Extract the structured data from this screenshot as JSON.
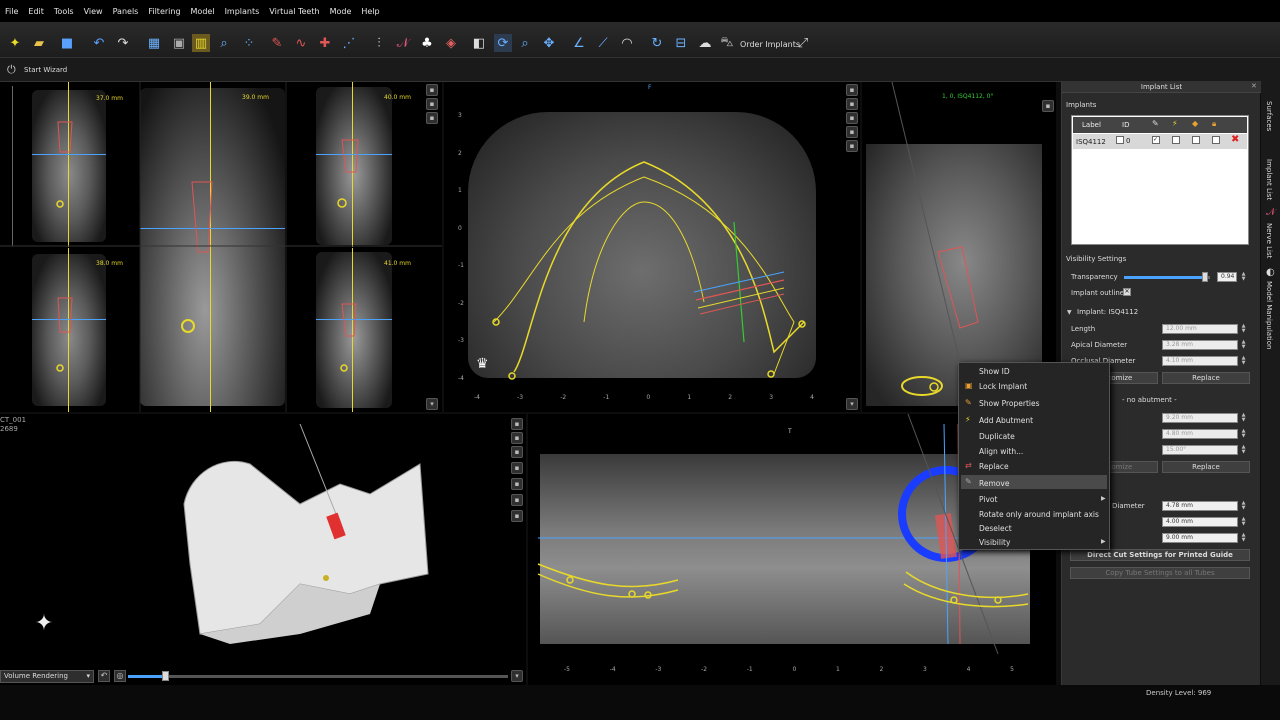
{
  "menu": [
    "File",
    "Edit",
    "Tools",
    "View",
    "Panels",
    "Filtering",
    "Model",
    "Implants",
    "Virtual Teeth",
    "Mode",
    "Help"
  ],
  "toolbar": {
    "order_label": "Order Implants"
  },
  "wizard": {
    "label": "Start Wizard"
  },
  "slices": {
    "mm1": "37.0 mm",
    "mm2": "39.0 mm",
    "mm3": "40.0 mm",
    "mm4": "38.0 mm",
    "mm5": "41.0 mm"
  },
  "axial": {
    "top_marker": "F",
    "tick_left": [
      "3",
      "2",
      "1",
      "0",
      "-1",
      "-2",
      "-3",
      "-4"
    ],
    "tick_bottom": [
      "-4",
      "-3",
      "-2",
      "-1",
      "0",
      "1",
      "2",
      "3",
      "4"
    ]
  },
  "cross": {
    "header": "1, 0, ISQ4112, 0°"
  },
  "volume": {
    "labels": [
      "CT_001",
      "2689"
    ],
    "mode_select": "Volume Rendering"
  },
  "pano": {
    "top_marker": "T",
    "ticks": [
      "-5",
      "-4",
      "-3",
      "-2",
      "-1",
      "0",
      "1",
      "2",
      "3",
      "4",
      "5"
    ]
  },
  "implant_list": {
    "title": "Implant List",
    "section": "Implants",
    "columns": [
      "Label",
      "ID"
    ],
    "row": {
      "label": "ISQ4112",
      "id": "0"
    },
    "visibility_title": "Visibility Settings",
    "transparency_label": "Transparency",
    "transparency_value": "0.94",
    "transparency_fraction": 0.94,
    "outline_label": "Implant outline",
    "implant_title": "Implant: ISQ4112",
    "length_label": "Length",
    "length_value": "12.00 mm",
    "apical_label": "Apical Diameter",
    "apical_value": "3.28 mm",
    "occlusal_label": "Occlusal Diameter",
    "occlusal_value": "4.10 mm",
    "customize_label": "Customize",
    "replace_label": "Replace",
    "abutment_title": "- no abutment -",
    "abut_val1": "9.20 mm",
    "abut_val2": "4.80 mm",
    "abut_val3": "15.00°",
    "diameter_label": "Diameter",
    "diam_val1": "4.78 mm",
    "diam_val2": "4.00 mm",
    "diam_val3": "9.00 mm",
    "direct_cut": "Direct Cut Settings for Printed Guide",
    "copy_tube": "Copy Tube Settings to all Tubes"
  },
  "vtabs": [
    "Surfaces",
    "Implant List",
    "Nerve List",
    "Model Manipulation"
  ],
  "context_menu": [
    "Show ID",
    "Lock Implant",
    "Show Properties",
    "Add Abutment",
    "Duplicate",
    "Align with...",
    "Replace",
    "Remove",
    "Pivot",
    "Rotate only around implant axis",
    "Deselect",
    "Visibility"
  ],
  "status": {
    "density": "Density Level: 969"
  },
  "colors": {
    "accent_yellow": "#e8d92a",
    "accent_blue": "#4aa3ff",
    "implant_red": "#e05555"
  }
}
